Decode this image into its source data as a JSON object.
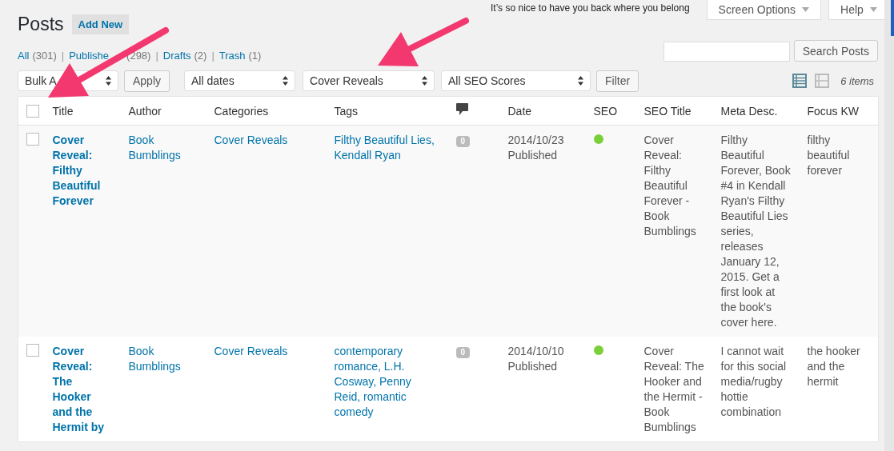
{
  "greeting": "It’s so nice to have you back where you belong",
  "screen_options": "Screen Options",
  "help": "Help",
  "page_title": "Posts",
  "add_new": "Add New",
  "views": [
    {
      "label": "All",
      "count": "(301)"
    },
    {
      "separator": "|",
      "label": "Publishe",
      "count": "(298)"
    },
    {
      "separator": "|",
      "label": "Drafts",
      "count": "(2)"
    },
    {
      "separator": "|",
      "label": "Trash",
      "count": "(1)"
    }
  ],
  "search_button": "Search Posts",
  "bulk_actions": "Bulk A",
  "apply": "Apply",
  "filters": [
    "All dates",
    "Cover Reveals",
    "All SEO Scores"
  ],
  "filter_button": "Filter",
  "view_modes": [
    {
      "kind": "list",
      "selected": true
    },
    {
      "kind": "excerpt",
      "selected": false
    }
  ],
  "item_count": "6 items",
  "table": {
    "select_all": {
      "checked": false
    },
    "columns": [
      {
        "kind": "text",
        "label": "Title"
      },
      {
        "kind": "text",
        "label": "Author"
      },
      {
        "kind": "text",
        "label": "Categories"
      },
      {
        "kind": "text",
        "label": "Tags"
      },
      {
        "kind": "comments"
      },
      {
        "kind": "text",
        "label": "Date"
      },
      {
        "kind": "text",
        "label": "SEO"
      },
      {
        "kind": "text",
        "label": "SEO Title"
      },
      {
        "kind": "text",
        "label": "Meta Desc."
      },
      {
        "kind": "text",
        "label": "Focus KW"
      }
    ],
    "rows": [
      {
        "checked": false,
        "title": "Cover Reveal: Filthy Beautiful Forever",
        "author": "Book Bumblings",
        "categories": "Cover Reveals",
        "tags": "Filthy Beautiful Lies, Kendall Ryan",
        "comments": "0",
        "date": "2014/10/23",
        "status": "Published",
        "color": "#7ad03a",
        "seo_title": "Cover Reveal: Filthy Beautiful Forever - Book Bumblings",
        "meta_desc": "Filthy Beautiful Forever, Book #4 in Kendall Ryan's Filthy Beautiful Lies series, releases January 12, 2015. Get a first look at the book's cover here.",
        "focus_kw": "filthy beautiful forever"
      },
      {
        "checked": false,
        "title": "Cover Reveal: The Hooker and the Hermit by",
        "author": "Book Bumblings",
        "categories": "Cover Reveals",
        "tags": "contemporary romance, L.H. Cosway, Penny Reid, romantic comedy",
        "comments": "0",
        "date": "2014/10/10",
        "status": "Published",
        "color": "#7ad03a",
        "seo_title": "Cover Reveal: The Hooker and the Hermit - Book Bumblings",
        "meta_desc": "I cannot wait for this social media/rugby hottie combination",
        "focus_kw": "the hooker and the hermit"
      }
    ]
  }
}
